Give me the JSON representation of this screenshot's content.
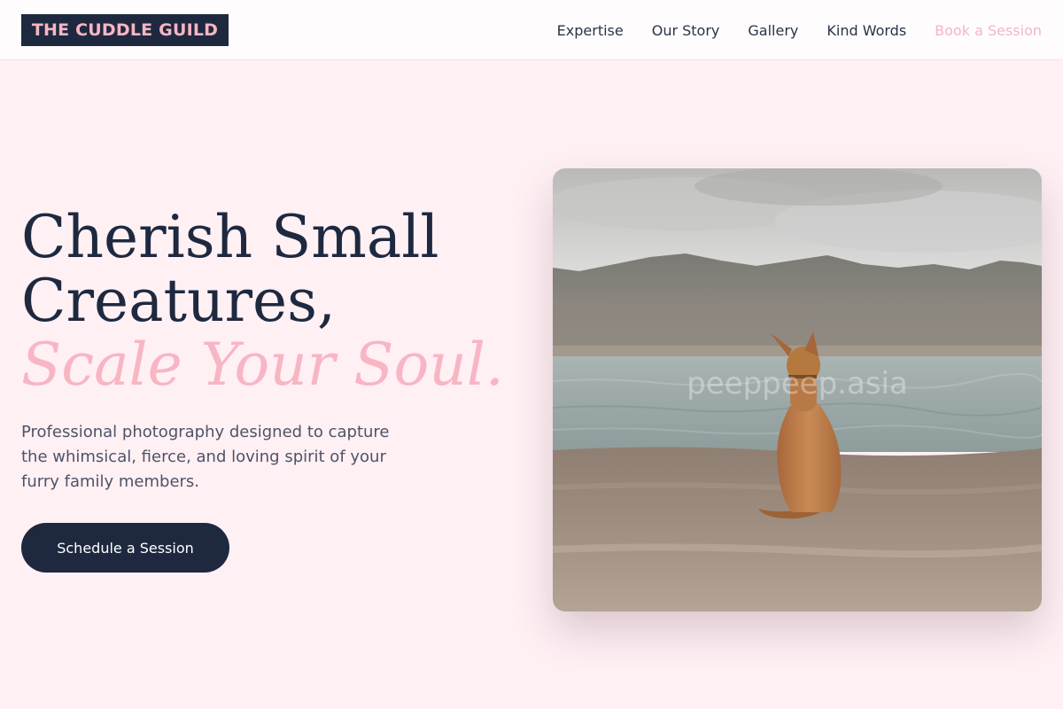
{
  "brand": {
    "name": "THE CUDDLE GUILD"
  },
  "nav": {
    "items": [
      {
        "label": "Expertise"
      },
      {
        "label": "Our Story"
      },
      {
        "label": "Gallery"
      },
      {
        "label": "Kind Words"
      }
    ],
    "cta_label": "Book a Session"
  },
  "hero": {
    "title_line1": "Cherish Small",
    "title_line2": "Creatures,",
    "title_accent": "Scale Your Soul.",
    "description": "Professional photography designed to capture the whimsical, fierce, and loving spirit of your furry family members.",
    "cta_label": "Schedule a Session"
  },
  "photo": {
    "watermark": "peeppeep.asia"
  },
  "colors": {
    "background": "#fff0f4",
    "navy": "#1e2940",
    "pink_accent": "#f8b5c3"
  }
}
